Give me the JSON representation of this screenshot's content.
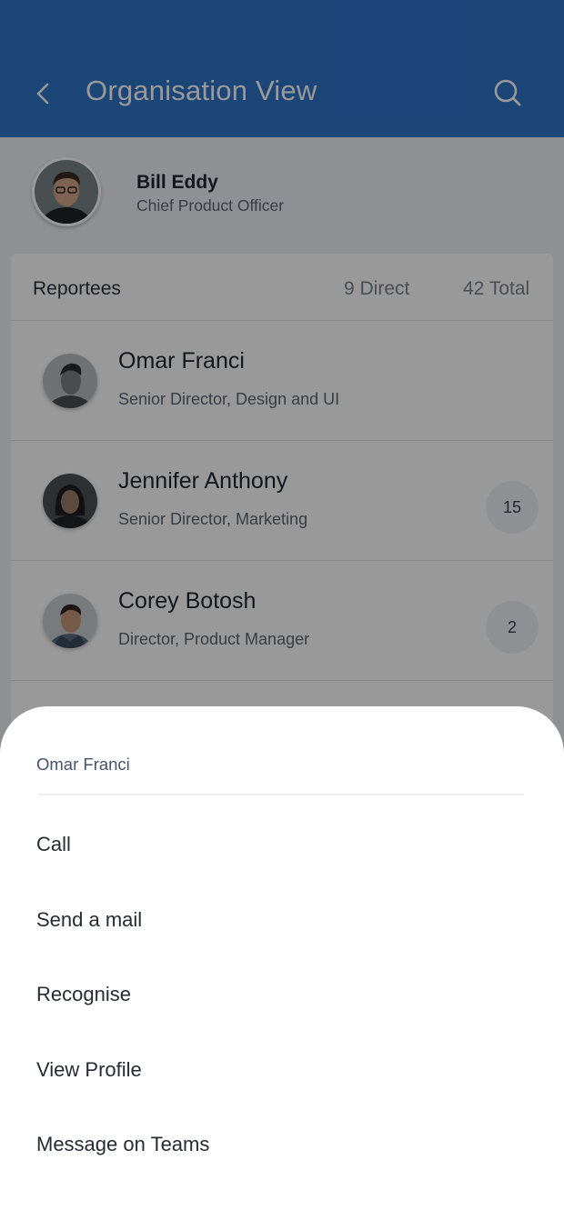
{
  "header": {
    "title": "Organisation View",
    "back_icon": "chevron-left-icon",
    "search_icon": "search-icon",
    "background": "#2f73c9"
  },
  "manager": {
    "name": "Bill Eddy",
    "title": "Chief Product Officer"
  },
  "reportees": {
    "label": "Reportees",
    "direct": "9 Direct",
    "total": "42 Total",
    "items": [
      {
        "name": "Omar Franci",
        "title": "Senior Director, Design and UI",
        "count": ""
      },
      {
        "name": "Jennifer Anthony",
        "title": "Senior Director, Marketing",
        "count": "15"
      },
      {
        "name": "Corey Botosh",
        "title": "Director, Product Manager",
        "count": "2"
      }
    ]
  },
  "action_sheet": {
    "title": "Omar Franci",
    "items": [
      "Call",
      "Send a mail",
      "Recognise",
      "View Profile",
      "Message on Teams"
    ]
  }
}
